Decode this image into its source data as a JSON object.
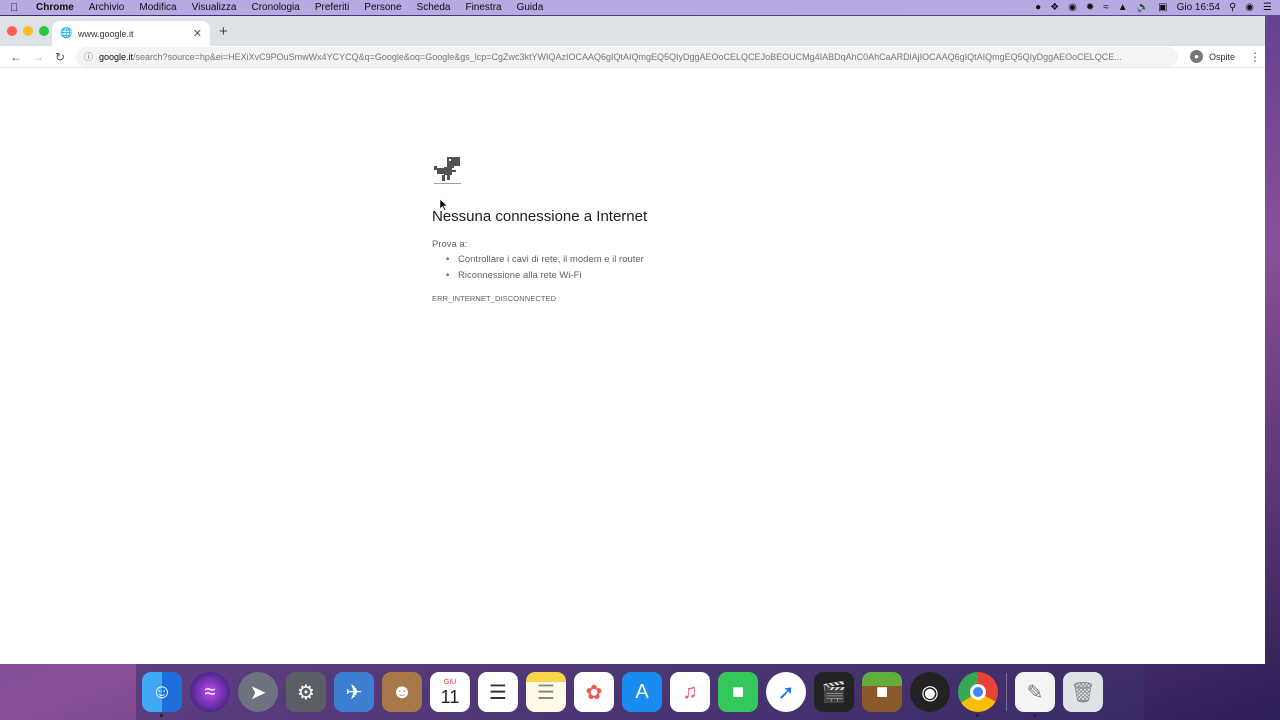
{
  "menubar": {
    "app": "Chrome",
    "items": [
      "Archivio",
      "Modifica",
      "Visualizza",
      "Cronologia",
      "Preferiti",
      "Persone",
      "Scheda",
      "Finestra",
      "Guida"
    ],
    "clock": "Gio 16:54"
  },
  "browser": {
    "tab_title": "www.google.it",
    "url_host": "google.it",
    "url_rest": "/search?source=hp&ei=HEXiXvC9POuSmwWx4YCYCQ&q=Google&oq=Google&gs_lcp=CgZwc3ktYWIQAzIOCAAQ6gIQtAIQmgEQ5QIyDggAEOoCELQCEJoBEOUCMg4IABDqAhC0AhCaARDlAjIOCAAQ6gIQtAIQmgEQ5QIyDggAEOoCELQCE...",
    "profile_label": "Ospite"
  },
  "page": {
    "title": "Nessuna connessione a Internet",
    "try_label": "Prova a:",
    "suggestions": [
      "Controllare i cavi di rete, il modem e il router",
      "Riconnessione alla rete Wi-Fi"
    ],
    "error_code": "ERR_INTERNET_DISCONNECTED"
  },
  "dock": {
    "calendar_month": "GIU",
    "calendar_day": "11"
  }
}
